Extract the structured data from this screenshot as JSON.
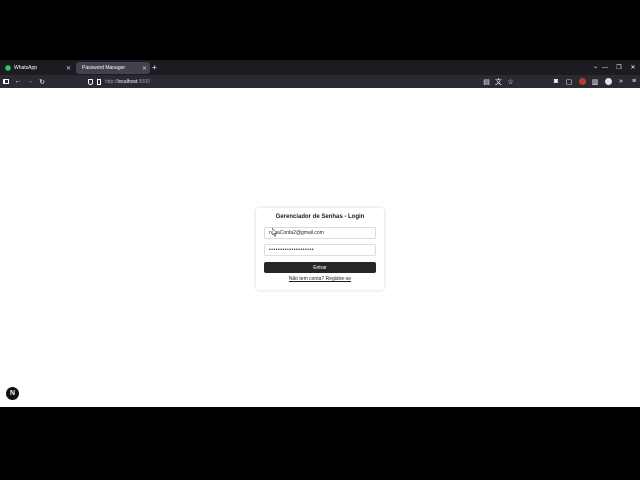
{
  "browser": {
    "tabs": [
      {
        "label": "WhatsApp",
        "active": false
      },
      {
        "label": "Password Manager",
        "active": true
      }
    ],
    "new_tab_symbol": "+",
    "address": {
      "scheme": "http://",
      "host": "localhost",
      "rest": ":3000"
    }
  },
  "login": {
    "title": "Gerenciador de Senhas - Login",
    "email_value": "novaConta2@gmail.com",
    "password_value": "••••••••••••••••••••",
    "submit_label": "Entrar",
    "signup_link": "Não tem conta? Registre-se"
  },
  "badge": {
    "label": "N"
  },
  "colors": {
    "tab_bar": "#1c1b22",
    "nav_bar": "#2b2a33",
    "button": "#262626",
    "whatsapp": "#25d366"
  }
}
